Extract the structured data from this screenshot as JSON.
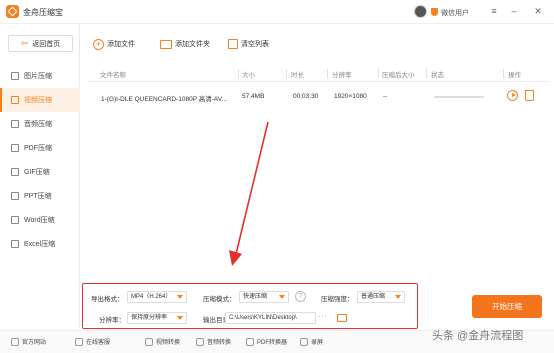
{
  "window": {
    "title": "金舟压缩宝",
    "user_label": "微信用户"
  },
  "sidebar": {
    "back_label": "返回首页",
    "items": [
      {
        "label": "图片压缩",
        "active": false
      },
      {
        "label": "视频压缩",
        "active": true
      },
      {
        "label": "音频压缩",
        "active": false
      },
      {
        "label": "PDF压缩",
        "active": false
      },
      {
        "label": "GIF压缩",
        "active": false
      },
      {
        "label": "PPT压缩",
        "active": false
      },
      {
        "label": "Word压缩",
        "active": false
      },
      {
        "label": "Excel压缩",
        "active": false
      }
    ]
  },
  "toolbar": {
    "add_file": "添加文件",
    "add_folder": "添加文件夹",
    "clear_list": "清空列表"
  },
  "table": {
    "headers": [
      "文件名称",
      "大小",
      "时长",
      "分辨率",
      "压缩后大小",
      "状态",
      "操作"
    ],
    "rows": [
      {
        "name": "1-(G)I-DLE QUEENCARD-1080P 高清-AV...",
        "size": "57.4MB",
        "duration": "00:03:30",
        "resolution": "1920×1080",
        "compressed_size": "--",
        "progress": 0
      }
    ]
  },
  "settings": {
    "format_label": "导出格式：",
    "format_value": "MP4（H.264）",
    "mode_label": "压缩模式：",
    "mode_value": "快速压缩",
    "strength_label": "压缩强度：",
    "strength_value": "普通压缩",
    "resolution_label": "分辨率：",
    "resolution_value": "保持原分辨率",
    "output_label": "输出目录：",
    "output_value": "C:\\Users\\KYLIN\\Desktop\\",
    "help": "?",
    "more": "···"
  },
  "start_label": "开始压缩",
  "footer": {
    "items": [
      "官方网站",
      "在线客服",
      "视频转换",
      "音频转换",
      "PDF转换器",
      "录屏"
    ]
  },
  "watermark": "头条 @金舟流程图",
  "colors": {
    "accent": "#f58220",
    "highlight_border": "#e0312f"
  }
}
